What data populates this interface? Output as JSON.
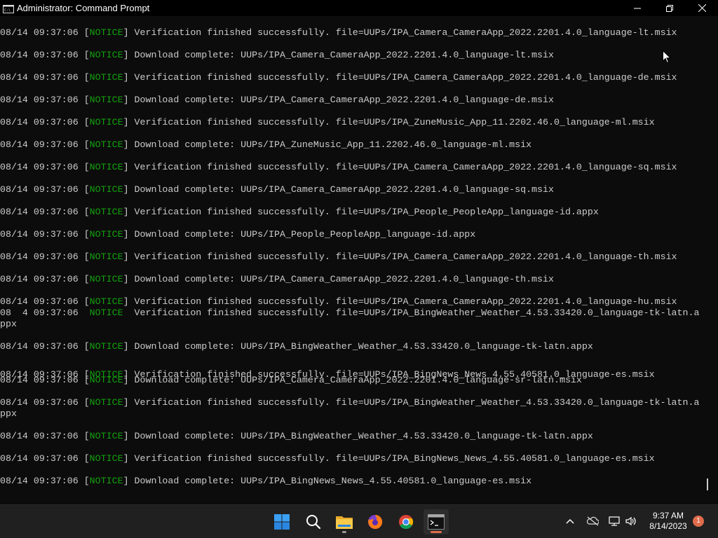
{
  "window": {
    "title": "Administrator: Command Prompt",
    "icon": "cmd-icon",
    "controls": [
      "minimize-icon",
      "maximize-icon",
      "close-icon"
    ]
  },
  "console": {
    "tag_color": "#13a10e",
    "lines": [
      {
        "pre": "08/14 09:37:06 [",
        "tag": "NOTICE",
        "post": "] Verification finished successfully. file=UUPs/IPA_Camera_CameraApp_2022.2201.4.0_language-lt.msix"
      },
      {
        "pre": "08/14 09:37:06 [",
        "tag": "NOTICE",
        "post": "] Download complete: UUPs/IPA_Camera_CameraApp_2022.2201.4.0_language-lt.msix"
      },
      {
        "pre": "08/14 09:37:06 [",
        "tag": "NOTICE",
        "post": "] Verification finished successfully. file=UUPs/IPA_Camera_CameraApp_2022.2201.4.0_language-de.msix"
      },
      {
        "pre": "08/14 09:37:06 [",
        "tag": "NOTICE",
        "post": "] Download complete: UUPs/IPA_Camera_CameraApp_2022.2201.4.0_language-de.msix"
      },
      {
        "pre": "08/14 09:37:06 [",
        "tag": "NOTICE",
        "post": "] Verification finished successfully. file=UUPs/IPA_ZuneMusic_App_11.2202.46.0_language-ml.msix"
      },
      {
        "pre": "08/14 09:37:06 [",
        "tag": "NOTICE",
        "post": "] Download complete: UUPs/IPA_ZuneMusic_App_11.2202.46.0_language-ml.msix"
      },
      {
        "pre": "08/14 09:37:06 [",
        "tag": "NOTICE",
        "post": "] Verification finished successfully. file=UUPs/IPA_Camera_CameraApp_2022.2201.4.0_language-sq.msix"
      },
      {
        "pre": "08/14 09:37:06 [",
        "tag": "NOTICE",
        "post": "] Download complete: UUPs/IPA_Camera_CameraApp_2022.2201.4.0_language-sq.msix"
      },
      {
        "pre": "08/14 09:37:06 [",
        "tag": "NOTICE",
        "post": "] Verification finished successfully. file=UUPs/IPA_People_PeopleApp_language-id.appx"
      },
      {
        "pre": "08/14 09:37:06 [",
        "tag": "NOTICE",
        "post": "] Download complete: UUPs/IPA_People_PeopleApp_language-id.appx"
      },
      {
        "pre": "08/14 09:37:06 [",
        "tag": "NOTICE",
        "post": "] Verification finished successfully. file=UUPs/IPA_Camera_CameraApp_2022.2201.4.0_language-th.msix"
      },
      {
        "pre": "08/14 09:37:06 [",
        "tag": "NOTICE",
        "post": "] Download complete: UUPs/IPA_Camera_CameraApp_2022.2201.4.0_language-th.msix"
      },
      {
        "pre": "08/14 09:37:06 [",
        "tag": "NOTICE",
        "post": "] Verification finished successfully. file=UUPs/IPA_Camera_CameraApp_2022.2201.4.0_language-hu.msix"
      },
      {
        "pre": "08  4 09:37:06  ",
        "tag": "NOTICE",
        "post": "  Verification finished successfully. file=UUPs/IPA_BingWeather_Weather_4.53.33420.0_language-tk-latn.a"
      },
      {
        "pre": "ppx",
        "tag": "",
        "post": ""
      },
      {
        "pre": "08/14 09:37:06 [",
        "tag": "NOTICE",
        "post": "] Download complete: UUPs/IPA_BingWeather_Weather_4.53.33420.0_language-tk-latn.appx"
      },
      {
        "pre": "08/14 09:37:06 [",
        "tag": "NOTICE",
        "post": "] Verification finished successfully. file=UUPs/IPA_BingNews_News_4.55.40581.0_language-es.msix"
      },
      {
        "pre": "08/14 09:37:06 [",
        "tag": "NOTICE",
        "post": "] Download complete: UUPs/IPA_Camera_CameraApp_2022.2201.4.0_language-sr-latn.msix"
      },
      {
        "pre": "08/14 09:37:06 [",
        "tag": "NOTICE",
        "post": "] Verification finished successfully. file=UUPs/IPA_BingWeather_Weather_4.53.33420.0_language-tk-latn.a"
      },
      {
        "pre": "ppx",
        "tag": "",
        "post": ""
      },
      {
        "pre": "08/14 09:37:06 [",
        "tag": "NOTICE",
        "post": "] Download complete: UUPs/IPA_BingWeather_Weather_4.53.33420.0_language-tk-latn.appx"
      },
      {
        "pre": "08/14 09:37:06 [",
        "tag": "NOTICE",
        "post": "] Verification finished successfully. file=UUPs/IPA_BingNews_News_4.55.40581.0_language-es.msix"
      },
      {
        "pre": "08/14 09:37:06 [",
        "tag": "NOTICE",
        "post": "] Download complete: UUPs/IPA_BingNews_News_4.55.40581.0_language-es.msix"
      }
    ]
  },
  "taskbar": {
    "apps": [
      {
        "name": "start-icon"
      },
      {
        "name": "search-icon"
      },
      {
        "name": "file-explorer-icon"
      },
      {
        "name": "firefox-icon"
      },
      {
        "name": "chrome-icon"
      },
      {
        "name": "terminal-icon"
      }
    ],
    "tray": {
      "icons": [
        "chevron-up-icon",
        "onedrive-icon",
        "network-icon",
        "volume-icon"
      ],
      "time": "9:37 AM",
      "date": "8/14/2023",
      "notification_count": "1"
    }
  }
}
